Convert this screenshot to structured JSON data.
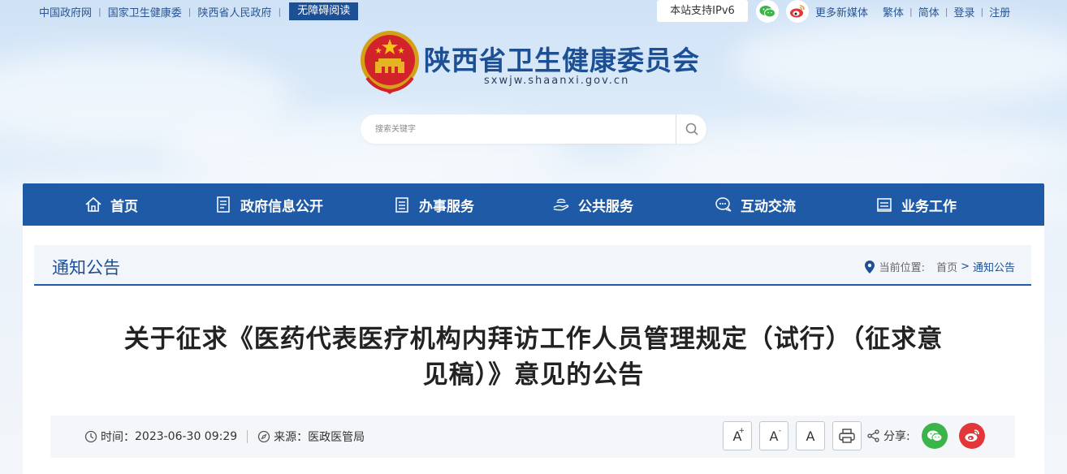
{
  "topbar": {
    "links": [
      "中国政府网",
      "国家卫生健康委",
      "陕西省人民政府"
    ],
    "accessibility": "无障碍阅读",
    "ipv6": "本站支持IPv6",
    "more_media": "更多新媒体",
    "right_links": [
      "繁体",
      "简体",
      "登录",
      "注册"
    ]
  },
  "site": {
    "title": "陕西省卫生健康委员会",
    "domain": "sxwjw.shaanxi.gov.cn"
  },
  "search": {
    "placeholder": "搜索关键字"
  },
  "nav": {
    "items": [
      {
        "label": "首页",
        "icon": "home-icon"
      },
      {
        "label": "政府信息公开",
        "icon": "document-icon"
      },
      {
        "label": "办事服务",
        "icon": "clipboard-icon"
      },
      {
        "label": "公共服务",
        "icon": "hand-service-icon"
      },
      {
        "label": "互动交流",
        "icon": "chat-icon"
      },
      {
        "label": "业务工作",
        "icon": "briefcase-icon"
      }
    ]
  },
  "section": {
    "title": "通知公告",
    "location_label": "当前位置:",
    "crumb_home": "首页",
    "crumb_arrow": ">",
    "crumb_current": "通知公告"
  },
  "article": {
    "title_line1": "关于征求《医药代表医疗机构内拜访工作人员管理规定（试行）（征求意",
    "title_line2": "见稿）》意见的公告",
    "time_label": "时间：",
    "time_value": "2023-06-30 09:29",
    "source_label": "来源：",
    "source_value": "医政医管局"
  },
  "tools": {
    "font_larger": "A",
    "font_larger_sup": "+",
    "font_smaller": "A",
    "font_smaller_sup": "-",
    "font_default": "A",
    "share_label": "分享:"
  },
  "colors": {
    "brand": "#1f5aa6",
    "wechat": "#3bb54a",
    "weibo": "#e2363a"
  }
}
